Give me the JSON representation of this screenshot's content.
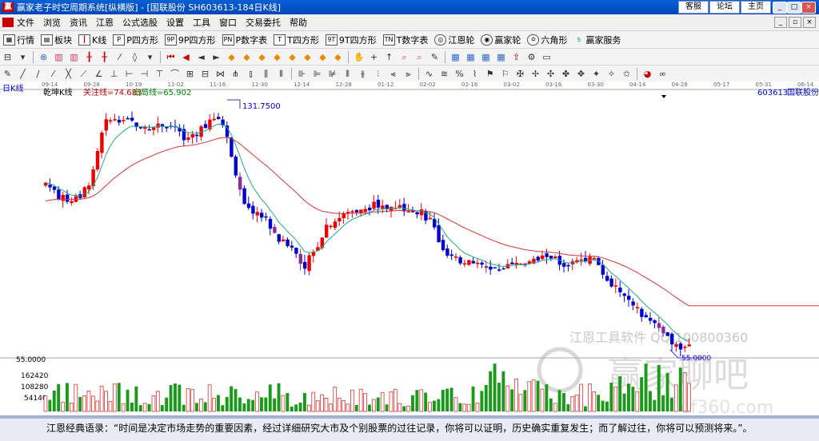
{
  "window": {
    "title": "赢家老子时空周期系统[纵横版] - [国联股份  SH603613-184日K线]",
    "links": [
      "客服",
      "论坛",
      "主页"
    ]
  },
  "menu": [
    "文件",
    "浏览",
    "资讯",
    "江恩",
    "公式选股",
    "设置",
    "工具",
    "窗口",
    "交易委托",
    "帮助"
  ],
  "toolbar": [
    "行情",
    "板块",
    "K线",
    "P四方形",
    "9P四方形",
    "P数字表",
    "T四方形",
    "9T四方形",
    "T数字表",
    "江恩轮",
    "赢家轮",
    "六角形",
    "赢家服务"
  ],
  "chart": {
    "panel_label": "日K线",
    "indicator_name": "乾坤K线",
    "attention_line": "关注线=74.683",
    "exit_line": "出局线=65.902",
    "stock_code": "603613",
    "stock_name": "国联股份",
    "high_label": "131.7500",
    "low_label": "55.0000",
    "watermark1": "江恩工具软件 QQ:100800360",
    "watermark2": "赢家聊吧",
    "watermark3": "ef360.com",
    "price_axis_label": "55.0000",
    "dates": [
      "09-14",
      "09-28",
      "10-19",
      "11-02",
      "11-16",
      "11-30",
      "12-14",
      "12-28",
      "01-12",
      "02-02",
      "02-16",
      "03-02",
      "03-16",
      "03-30",
      "04-14",
      "04-28",
      "05-17",
      "05-31",
      "06-14"
    ],
    "volume_ticks": [
      "162420",
      "108280",
      "54140"
    ],
    "price_tick": "55.0000"
  },
  "chart_data": {
    "type": "candlestick",
    "x_ticks": [
      "09-14",
      "09-28",
      "10-19",
      "11-02",
      "11-16",
      "11-30",
      "12-14",
      "12-28",
      "01-12",
      "02-02",
      "02-16",
      "03-02",
      "03-16",
      "03-30",
      "04-14",
      "04-28",
      "05-17",
      "05-31",
      "06-14"
    ],
    "price_high": 131.75,
    "price_low": 55.0,
    "volume_ticks": [
      162420,
      108280,
      54140
    ],
    "close_path": [
      108,
      104,
      102,
      104,
      110,
      126,
      128,
      127,
      126,
      125,
      126,
      125,
      120,
      124,
      127,
      128,
      115,
      100,
      99,
      96,
      90,
      89,
      82,
      87,
      95,
      97,
      99,
      100,
      101,
      100,
      101,
      100,
      99,
      96,
      86,
      84,
      84,
      82,
      81,
      82,
      84,
      83,
      84,
      86,
      83,
      83,
      85,
      84,
      78,
      74,
      72,
      66,
      64,
      60,
      58,
      57
    ]
  },
  "status": {
    "quote": "江恩经典语录：“时间是决定市场走势的重要因素，经过详细研究大市及个别股票的过往记录，你将可以证明，历史确实重复发生；而了解过往，你将可以预测将来。”。"
  }
}
